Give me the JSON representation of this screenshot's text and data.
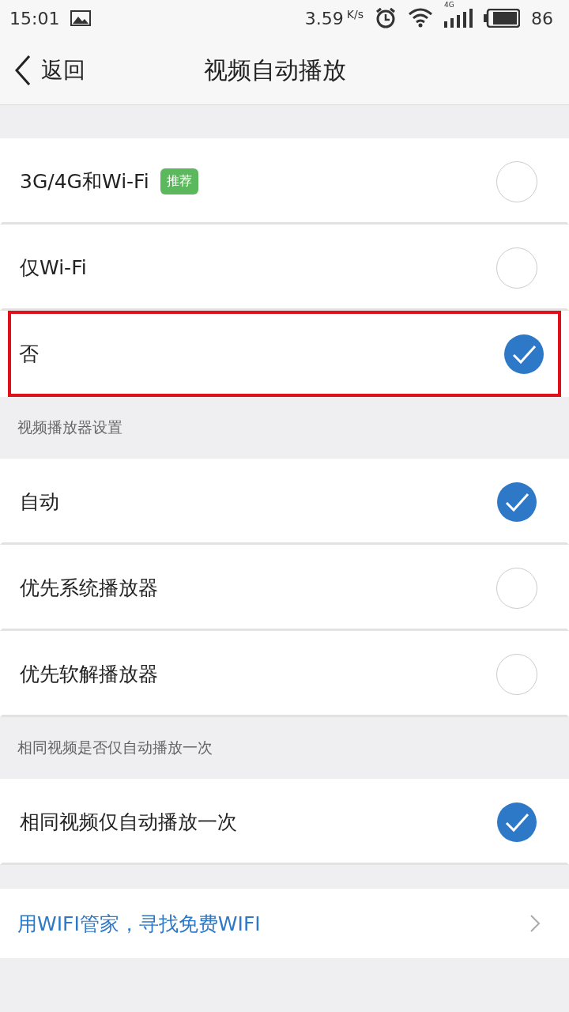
{
  "status_bar": {
    "time": "15:01",
    "speed": "3.59",
    "speed_unit": "K/s",
    "network": "4G",
    "battery": "86"
  },
  "nav": {
    "back": "返回",
    "title": "视频自动播放"
  },
  "sections": [
    {
      "options": [
        {
          "label": "3G/4G和Wi-Fi",
          "badge": "推荐",
          "selected": false,
          "highlighted": false
        },
        {
          "label": "仅Wi-Fi",
          "selected": false,
          "highlighted": false
        },
        {
          "label": "否",
          "selected": true,
          "highlighted": true
        }
      ]
    },
    {
      "header": "视频播放器设置",
      "options": [
        {
          "label": "自动",
          "selected": true,
          "highlighted": false
        },
        {
          "label": "优先系统播放器",
          "selected": false,
          "highlighted": false
        },
        {
          "label": "优先软解播放器",
          "selected": false,
          "highlighted": false
        }
      ]
    },
    {
      "header": "相同视频是否仅自动播放一次",
      "options": [
        {
          "label": "相同视频仅自动播放一次",
          "selected": true,
          "highlighted": false
        }
      ]
    }
  ],
  "link": {
    "label": "用WIFI管家，寻找免费WIFI"
  }
}
